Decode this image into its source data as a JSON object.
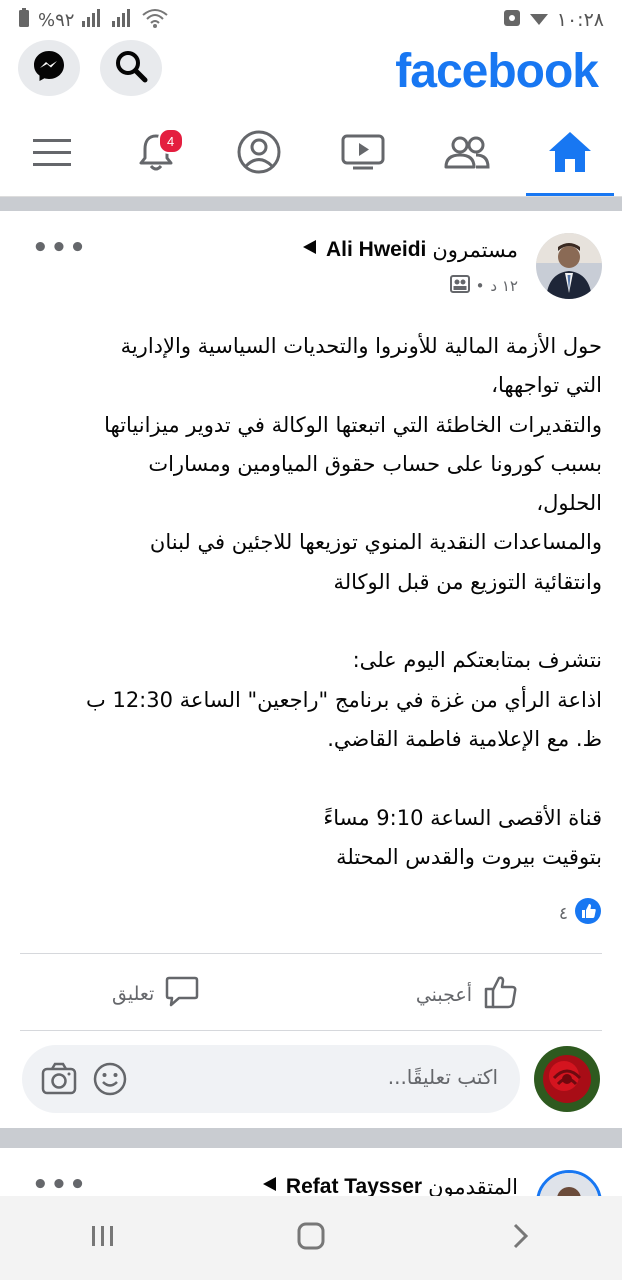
{
  "status_bar": {
    "time": "١٠:٢٨",
    "battery": "%٩٢",
    "icons": [
      "battery-icon",
      "signal-icon",
      "signal-icon",
      "wifi-icon",
      "media-icon",
      "data-icon"
    ]
  },
  "header": {
    "logo": "facebook",
    "left_buttons": [
      "messenger-icon",
      "search-icon"
    ]
  },
  "nav": {
    "tabs": [
      {
        "name": "home",
        "icon": "home-icon",
        "active": true
      },
      {
        "name": "friends",
        "icon": "friends-icon"
      },
      {
        "name": "watch",
        "icon": "video-icon"
      },
      {
        "name": "profile",
        "icon": "profile-icon"
      },
      {
        "name": "notifications",
        "icon": "bell-icon",
        "badge": "4"
      },
      {
        "name": "menu",
        "icon": "menu-icon"
      }
    ]
  },
  "post1": {
    "author": "Ali Hweidi",
    "group": "مستمرون",
    "time": "١٢ د",
    "lines": [
      "حول الأزمة المالية للأونروا والتحديات السياسية والإدارية",
      "التي تواجهها،",
      "والتقديرات الخاطئة التي اتبعتها الوكالة في تدوير ميزانياتها",
      "بسبب كورونا على حساب حقوق المياومين ومسارات",
      "الحلول،",
      "والمساعدات النقدية المنوي توزيعها للاجئين في لبنان",
      "وانتقائية التوزيع من قبل الوكالة",
      "",
      "نتشرف بمتابعتكم اليوم على:",
      "اذاعة الرأي من غزة في برنامج \"راجعين\" الساعة 12:30 ب",
      "ظ. مع الإعلامية فاطمة القاضي.",
      "",
      "قناة الأقصى الساعة 9:10 مساءً",
      "بتوقيت بيروت والقدس المحتلة"
    ],
    "reaction_count": "٤",
    "like_label": "أعجبني",
    "comment_label": "تعليق",
    "comment_placeholder": "اكتب تعليقًا..."
  },
  "post2": {
    "author": "Refat Taysser",
    "group": "المتقدمون"
  },
  "colors": {
    "brand": "#1877f2",
    "badge": "#e41e3f",
    "separator": "#c9ccd1"
  }
}
